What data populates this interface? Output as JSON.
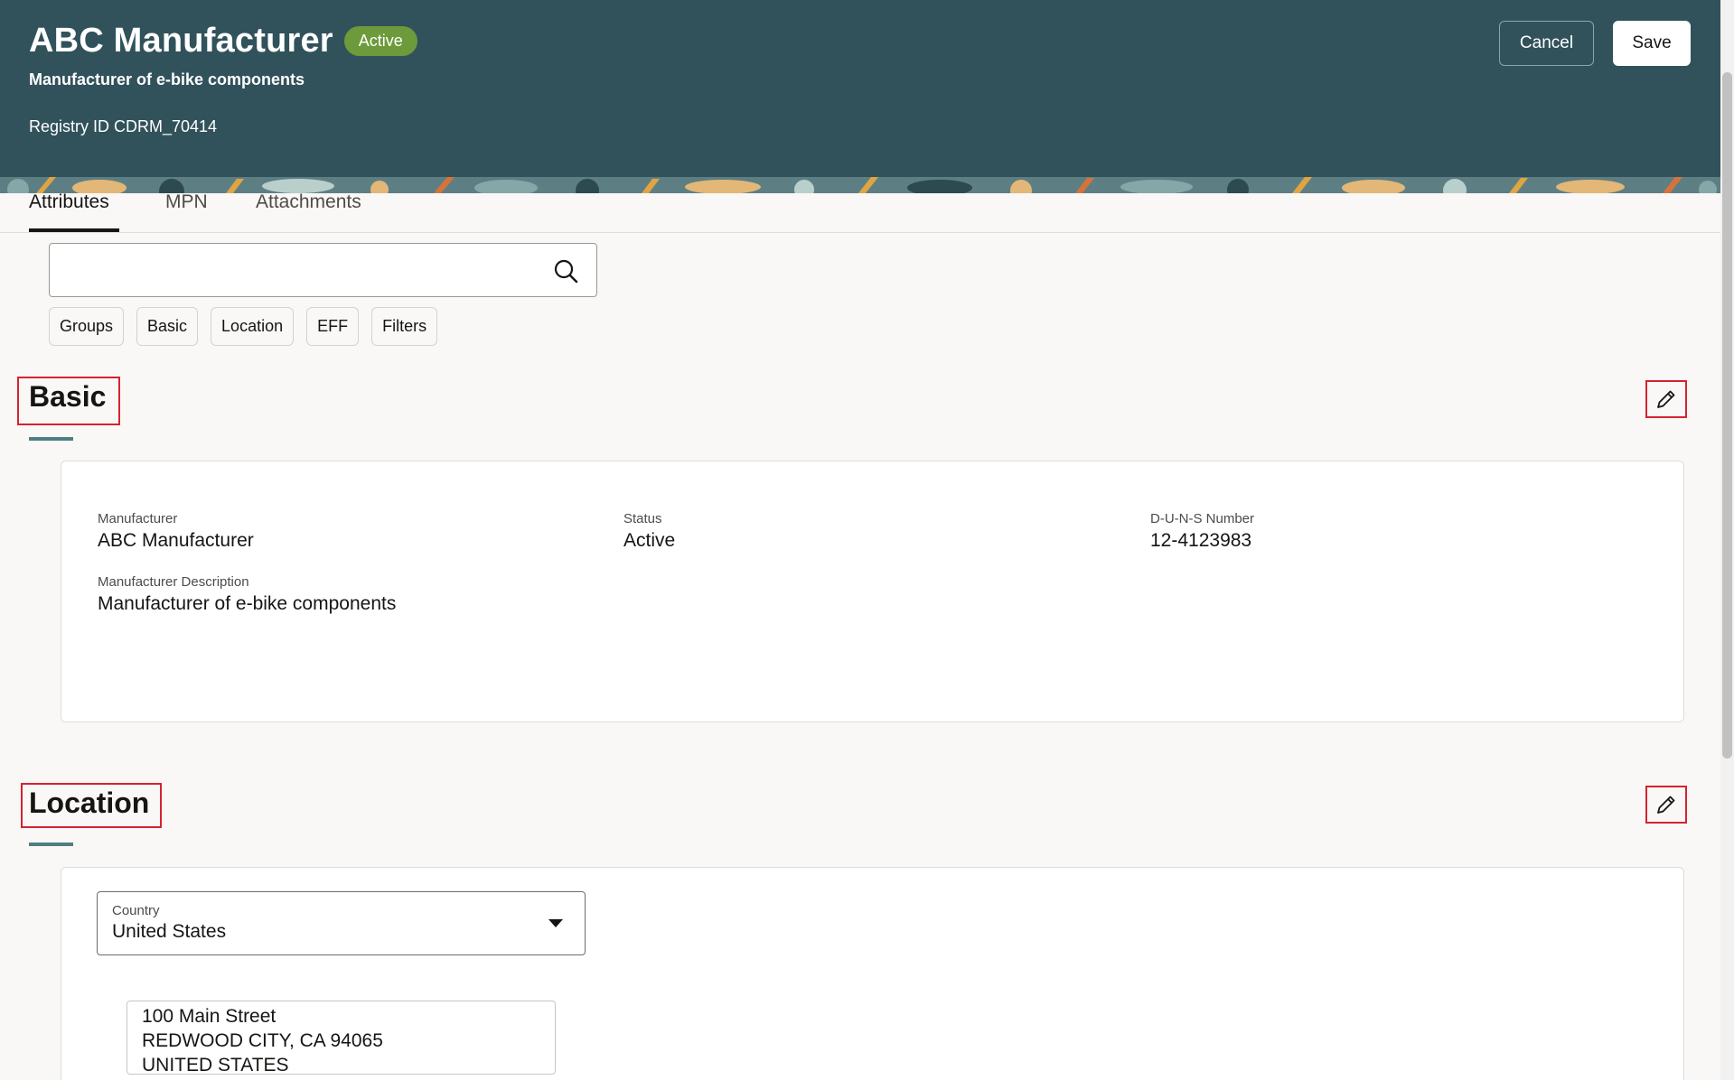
{
  "header": {
    "title": "ABC Manufacturer",
    "status_badge": "Active",
    "subtitle": "Manufacturer of e-bike components",
    "registry": "Registry ID CDRM_70414",
    "cancel_label": "Cancel",
    "save_label": "Save"
  },
  "tabs": [
    {
      "label": "Attributes",
      "active": true
    },
    {
      "label": "MPN",
      "active": false
    },
    {
      "label": "Attachments",
      "active": false
    }
  ],
  "search": {
    "value": "",
    "placeholder": ""
  },
  "chips": [
    "Groups",
    "Basic",
    "Location",
    "EFF",
    "Filters"
  ],
  "basic": {
    "title": "Basic",
    "fields": {
      "manufacturer": {
        "label": "Manufacturer",
        "value": "ABC Manufacturer"
      },
      "status": {
        "label": "Status",
        "value": "Active"
      },
      "duns": {
        "label": "D-U-N-S Number",
        "value": "12-4123983"
      },
      "description": {
        "label": "Manufacturer Description",
        "value": "Manufacturer of e-bike components"
      }
    }
  },
  "location": {
    "title": "Location",
    "country": {
      "label": "Country",
      "value": "United States"
    },
    "address_lines": [
      "100 Main Street",
      "REDWOOD CITY, CA 94065",
      "UNITED STATES"
    ]
  },
  "icons": {
    "search": "search-icon",
    "edit": "pencil-icon",
    "dropdown": "caret-down-icon"
  },
  "colors": {
    "header_bg": "#31525b",
    "badge_bg": "#6d9a3b",
    "highlight": "#d42330",
    "section_rule": "#4e7f82"
  }
}
